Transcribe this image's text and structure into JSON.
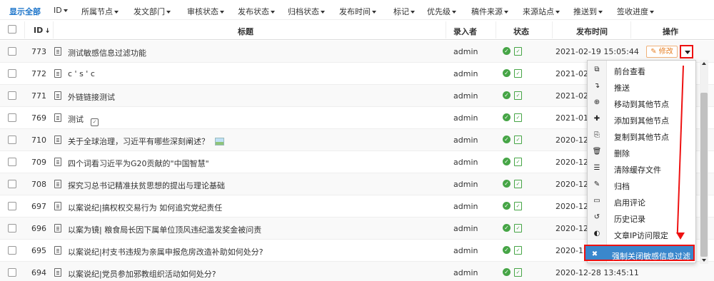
{
  "filters": [
    {
      "label": "显示全部",
      "dropdown": false
    },
    {
      "label": "ID",
      "dropdown": true
    },
    {
      "label": "所属节点",
      "dropdown": true
    },
    {
      "label": "发文部门",
      "dropdown": true
    },
    {
      "label": "审核状态",
      "dropdown": true
    },
    {
      "label": "发布状态",
      "dropdown": true
    },
    {
      "label": "归档状态",
      "dropdown": true
    },
    {
      "label": "发布时间",
      "dropdown": true
    },
    {
      "label": "标记",
      "dropdown": true
    },
    {
      "label": "优先级",
      "dropdown": true
    },
    {
      "label": "稿件来源",
      "dropdown": true
    },
    {
      "label": "来源站点",
      "dropdown": true
    },
    {
      "label": "推送到",
      "dropdown": true
    },
    {
      "label": "签收进度",
      "dropdown": true
    }
  ],
  "table": {
    "headers": {
      "id": "ID",
      "title": "标题",
      "author": "录入者",
      "status": "状态",
      "time": "发布时间",
      "actions": "操作"
    },
    "rows": [
      {
        "id": "773",
        "title": "测试敏感信息过滤功能",
        "author": "admin",
        "time": "2021-02-19 15:05:44",
        "extra": ""
      },
      {
        "id": "772",
        "title": "c ' s ' c",
        "author": "admin",
        "time": "2021-02",
        "extra": ""
      },
      {
        "id": "771",
        "title": "外链链接测试",
        "author": "admin",
        "time": "2021-02",
        "extra": ""
      },
      {
        "id": "769",
        "title": "测试",
        "author": "admin",
        "time": "2021-01-",
        "extra": "task-icon"
      },
      {
        "id": "710",
        "title": "关于全球治理，习近平有哪些深刻阐述？",
        "author": "admin",
        "time": "2020-12-",
        "extra": "image-icon"
      },
      {
        "id": "709",
        "title": "四个词看习近平为G20贡献的\"中国智慧\"",
        "author": "admin",
        "time": "2020-12-",
        "extra": ""
      },
      {
        "id": "708",
        "title": "探究习总书记精准扶贫思想的提出与理论基础",
        "author": "admin",
        "time": "2020-12-",
        "extra": ""
      },
      {
        "id": "697",
        "title": "以案说纪|搞权权交易行为 如何追究党纪责任",
        "author": "admin",
        "time": "2020-12-",
        "extra": ""
      },
      {
        "id": "696",
        "title": "以案为镜| 粮食局长因下属单位顶风违纪滥发奖金被问责",
        "author": "admin",
        "time": "2020-12-",
        "extra": ""
      },
      {
        "id": "695",
        "title": "以案说纪|村支书违规为亲属申报危房改造补助如何处分?",
        "author": "admin",
        "time": "2020-12-",
        "extra": ""
      },
      {
        "id": "694",
        "title": "以案说纪|党员参加邪教组织活动如何处分?",
        "author": "admin",
        "time": "2020-12-28 13:45:11",
        "extra": ""
      }
    ]
  },
  "actions": {
    "edit_label": "修改"
  },
  "menu": [
    {
      "label": "前台查看",
      "icon": "preview-icon",
      "glyph": "⧉"
    },
    {
      "label": "推送",
      "icon": "push-icon",
      "glyph": "↴"
    },
    {
      "label": "移动到其他节点",
      "icon": "move-icon",
      "glyph": "⊕"
    },
    {
      "label": "添加到其他节点",
      "icon": "add-icon",
      "glyph": "✚"
    },
    {
      "label": "复制到其他节点",
      "icon": "copy-icon",
      "glyph": "⎘"
    },
    {
      "label": "删除",
      "icon": "trash-icon",
      "glyph": "🗑"
    },
    {
      "label": "清除缓存文件",
      "icon": "clear-cache-icon",
      "glyph": "☰"
    },
    {
      "label": "归档",
      "icon": "archive-icon",
      "glyph": "✎"
    },
    {
      "label": "启用评论",
      "icon": "comment-icon",
      "glyph": "▭"
    },
    {
      "label": "历史记录",
      "icon": "history-icon",
      "glyph": "↺"
    },
    {
      "label": "文章IP访问限定",
      "icon": "ip-restrict-icon",
      "glyph": "◐"
    },
    {
      "label": "强制关闭敏感信息过滤",
      "icon": "close-icon",
      "glyph": "✖",
      "highlighted": true
    }
  ],
  "colors": {
    "link": "#1a73c9",
    "ok": "#46a546",
    "highlight": "#3a87cc",
    "annotation": "#e11"
  }
}
